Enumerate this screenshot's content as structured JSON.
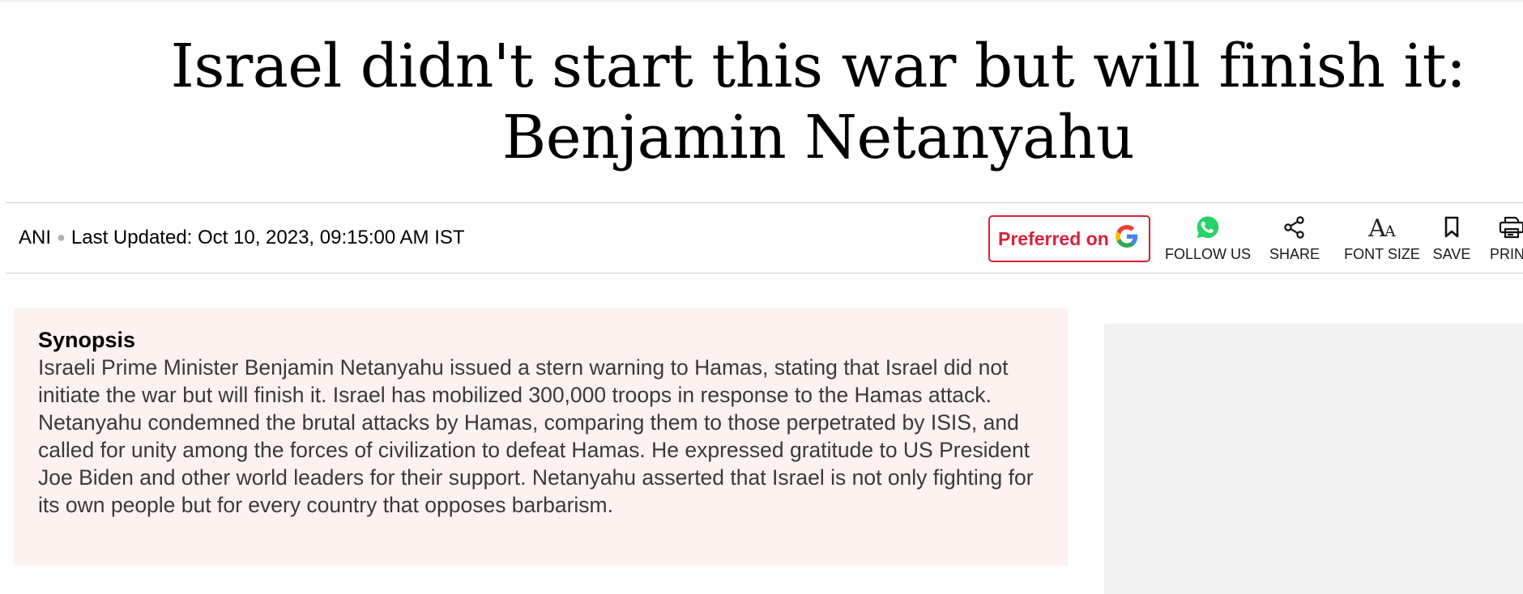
{
  "article": {
    "headline_line1": "Israel didn't start this war but will finish it:",
    "headline_line2": "Benjamin Netanyahu",
    "source": "ANI",
    "last_updated": "Last Updated: Oct 10, 2023, 09:15:00 AM IST"
  },
  "toolbar": {
    "preferred_label": "Preferred on",
    "preferred_icon": "google-g-icon",
    "follow_label": "FOLLOW US",
    "follow_icon": "whatsapp-icon",
    "share_label": "SHARE",
    "share_icon": "share-icon",
    "font_size_label": "FONT SIZE",
    "font_size_icon": "font-size-icon",
    "save_label": "SAVE",
    "save_icon": "bookmark-icon",
    "print_label": "PRINT",
    "print_icon": "printer-icon"
  },
  "synopsis": {
    "heading": "Synopsis",
    "text": "Israeli Prime Minister Benjamin Netanyahu issued a stern warning to Hamas, stating that Israel did not initiate the war but will finish it. Israel has mobilized 300,000 troops in response to the Hamas attack. Netanyahu condemned the brutal attacks by Hamas, comparing them to those perpetrated by ISIS, and called for unity among the forces of civilization to defeat Hamas. He expressed gratitude to US President Joe Biden and other world leaders for their support. Netanyahu asserted that Israel is not only fighting for its own people but for every country that opposes barbarism."
  },
  "colors": {
    "accent_red": "#d9213b",
    "whatsapp_green": "#25d366",
    "synopsis_bg": "#fef2f0",
    "ad_bg": "#f2f2f2"
  }
}
